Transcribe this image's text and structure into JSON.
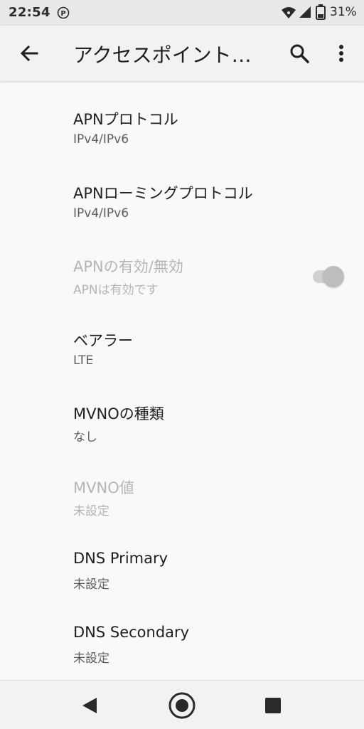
{
  "status_bar": {
    "time": "22:54",
    "battery_percent": "31%",
    "icons": [
      "p-notification-icon",
      "wifi-icon",
      "cell-signal-icon",
      "battery-icon"
    ]
  },
  "app_bar": {
    "title": "アクセスポイント…",
    "back_icon": "arrow-back-icon",
    "search_icon": "search-icon",
    "more_icon": "more-vert-icon"
  },
  "settings": [
    {
      "title": "APNプロトコル",
      "summary": "IPv4/IPv6",
      "enabled": true
    },
    {
      "title": "APNローミングプロトコル",
      "summary": "IPv4/IPv6",
      "enabled": true
    },
    {
      "title": "APNの有効/無効",
      "summary": "APNは有効です",
      "enabled": false,
      "toggle": "on"
    },
    {
      "title": "ベアラー",
      "summary": "LTE",
      "enabled": true
    },
    {
      "title": "MVNOの種類",
      "summary": "なし",
      "enabled": true
    },
    {
      "title": "MVNO値",
      "summary": "未設定",
      "enabled": false
    },
    {
      "title": "DNS Primary",
      "summary": "未設定",
      "enabled": true
    },
    {
      "title": "DNS Secondary",
      "summary": "未設定",
      "enabled": true
    }
  ],
  "nav_bar": {
    "icons": [
      "nav-back-icon",
      "nav-home-icon",
      "nav-recents-icon"
    ]
  },
  "colors": {
    "background": "#f9f9f9",
    "status_bar": "#e8e8e8",
    "app_bar": "#f2f2f2",
    "primary_text": "#202020",
    "secondary_text": "#5e5e5e",
    "disabled_text": "#b5b5b5"
  }
}
